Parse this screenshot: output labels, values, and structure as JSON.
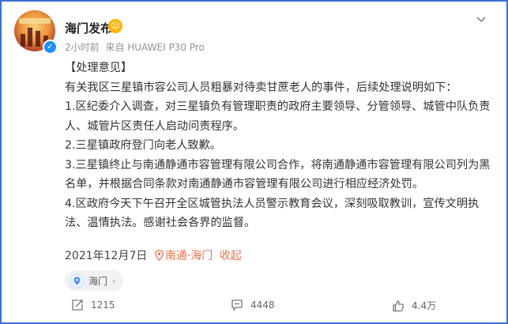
{
  "post": {
    "author": {
      "name": "海门发布",
      "avatar_icon": "avatar-image"
    },
    "meta": {
      "time": "2小时前",
      "source": "来自 HUAWEI P30 Pro"
    },
    "content": {
      "heading": "【处理意见】",
      "paragraphs": [
        "有关我区三星镇市容公司人员粗暴对待卖甘蔗老人的事件，后续处理说明如下：",
        "1.区纪委介入调查，对三星镇负有管理职责的政府主要领导、分管领导、城管中队负责人、城管片区责任人启动问责程序。",
        "2.三星镇政府登门向老人致歉。",
        "3.三星镇终止与南通静通市容管理有限公司合作，将南通静通市容管理有限公司列为黑名单，并根据合同条款对南通静通市容管理有限公司进行相应经济处罚。",
        "4.区政府今天下午召开全区城管执法人员警示教育会议，深刻吸取教训，宣传文明执法、温情执法。感谢社会各界的监督。"
      ]
    },
    "footer": {
      "date": "2021年12月7日",
      "location": "南通·海门",
      "fold_label": "收起"
    },
    "location_chip": {
      "label": "海门"
    },
    "actions": {
      "repost_count": "1215",
      "comment_count": "4448",
      "like_count": "4.4万"
    }
  },
  "colors": {
    "frame_border": "#3c6fd1",
    "link_orange": "#eb7350",
    "verified_blue": "#1e90ff",
    "meta_gray": "#939393"
  }
}
